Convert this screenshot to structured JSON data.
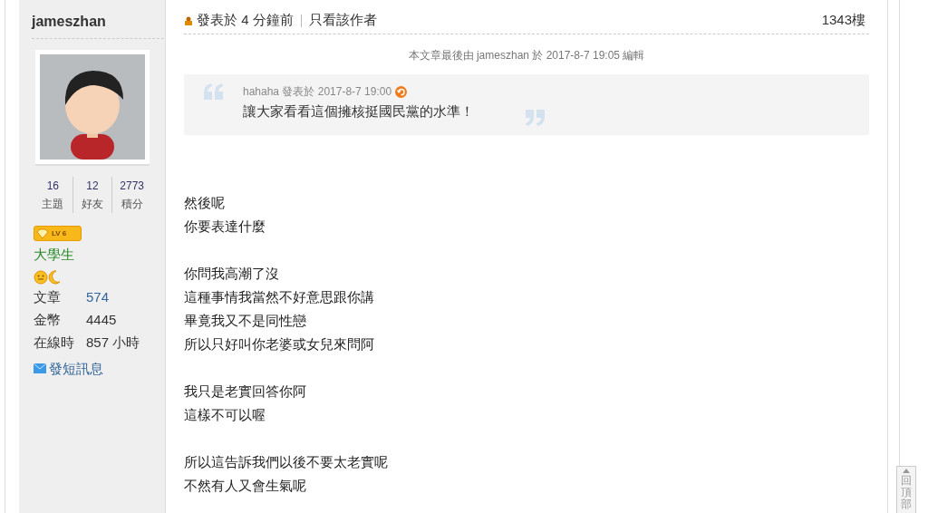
{
  "author": {
    "username": "jameszhan",
    "stats": [
      {
        "value": "16",
        "label": "主題"
      },
      {
        "value": "12",
        "label": "好友"
      },
      {
        "value": "2773",
        "label": "積分"
      }
    ],
    "level_badge": "LV 6",
    "rank": "大學生",
    "details": [
      {
        "label": "文章",
        "value": "574",
        "link": true
      },
      {
        "label": "金幣",
        "value": "4445",
        "link": false
      },
      {
        "label": "在線時",
        "value": "857 小時",
        "link": false
      }
    ],
    "message_link": "發短訊息"
  },
  "post": {
    "posted": "發表於 4 分鐘前",
    "author_only": "只看該作者",
    "floor": "1343樓",
    "edit_note": "本文章最後由 jameszhan 於 2017-8-7 19:05 編輯",
    "quote": {
      "meta": "hahaha 發表於 2017-8-7 19:00",
      "text": "讓大家看看這個擁核挺國民黨的水準！"
    },
    "paragraphs": [
      [
        "然後呢",
        "你要表達什麼"
      ],
      [
        "你問我高潮了沒",
        "這種事情我當然不好意思跟你講",
        "畢竟我又不是同性戀",
        "所以只好叫你老婆或女兒來問阿"
      ],
      [
        "我只是老實回答你阿",
        "這樣不可以喔"
      ],
      [
        "所以這告訴我們以後不要太老實呢",
        "不然有人又會生氣呢"
      ]
    ]
  },
  "back_to_top": "回頂部"
}
